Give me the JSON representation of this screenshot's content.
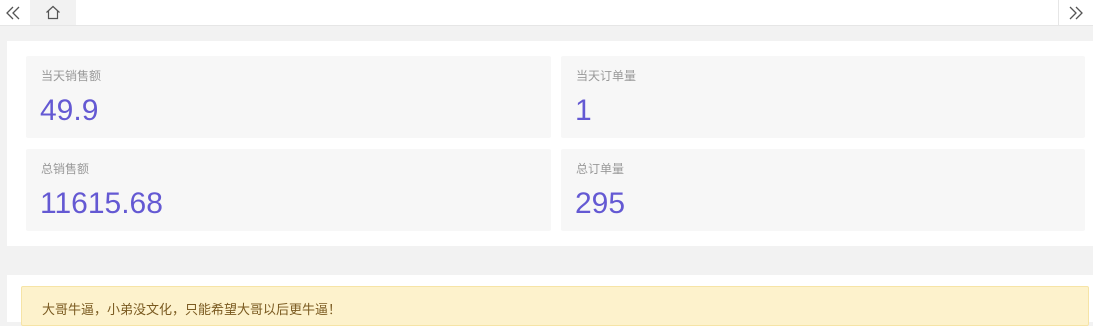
{
  "tabbar": {
    "scroll_left_icon": "double-chevron-left-icon",
    "home_icon": "home-icon",
    "scroll_right_icon": "double-chevron-right-icon"
  },
  "stats": [
    {
      "label": "当天销售额",
      "value": "49.9"
    },
    {
      "label": "当天订单量",
      "value": "1"
    },
    {
      "label": "总销售额",
      "value": "11615.68"
    },
    {
      "label": "总订单量",
      "value": "295"
    }
  ],
  "notice": {
    "text": "大哥牛逼，小弟没文化，只能希望大哥以后更牛逼！"
  },
  "colors": {
    "accent_value": "#6459d3",
    "notice_bg": "#fdf2cc",
    "card_bg": "#f7f7f7"
  }
}
